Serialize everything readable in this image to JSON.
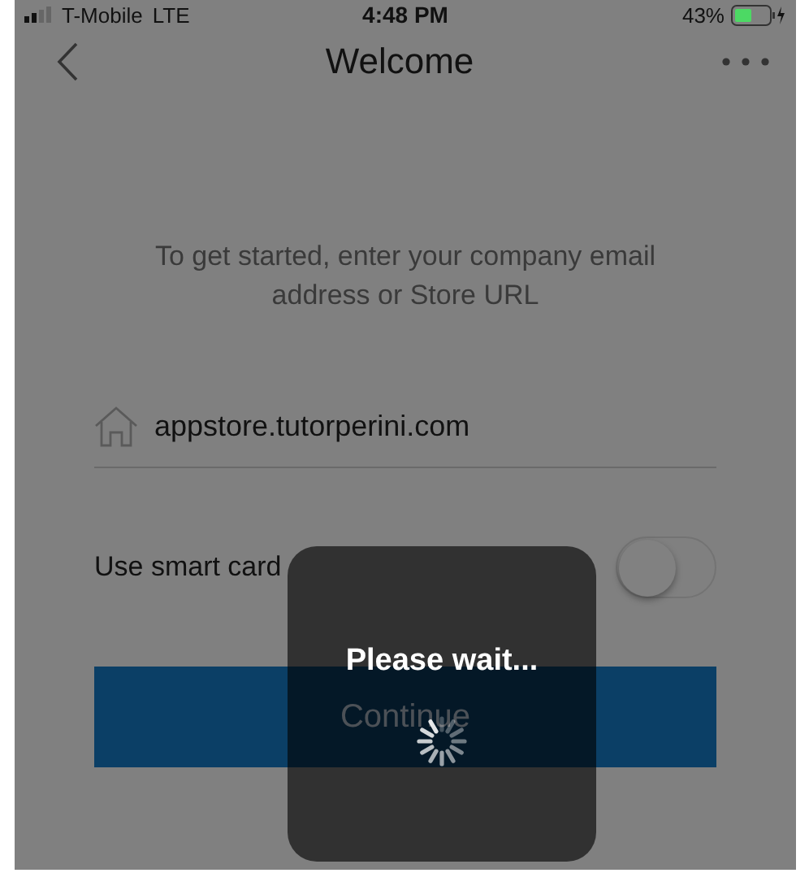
{
  "status_bar": {
    "carrier": "T-Mobile",
    "network": "LTE",
    "time": "4:48 PM",
    "battery": "43%"
  },
  "nav": {
    "title": "Welcome"
  },
  "instructions": "To get started, enter your company email address or Store URL",
  "store_field": {
    "value": "appstore.tutorperini.com"
  },
  "smart_card": {
    "label": "Use smart card",
    "on": false
  },
  "continue_button": {
    "label": "Continue"
  },
  "loading": {
    "message": "Please wait..."
  }
}
